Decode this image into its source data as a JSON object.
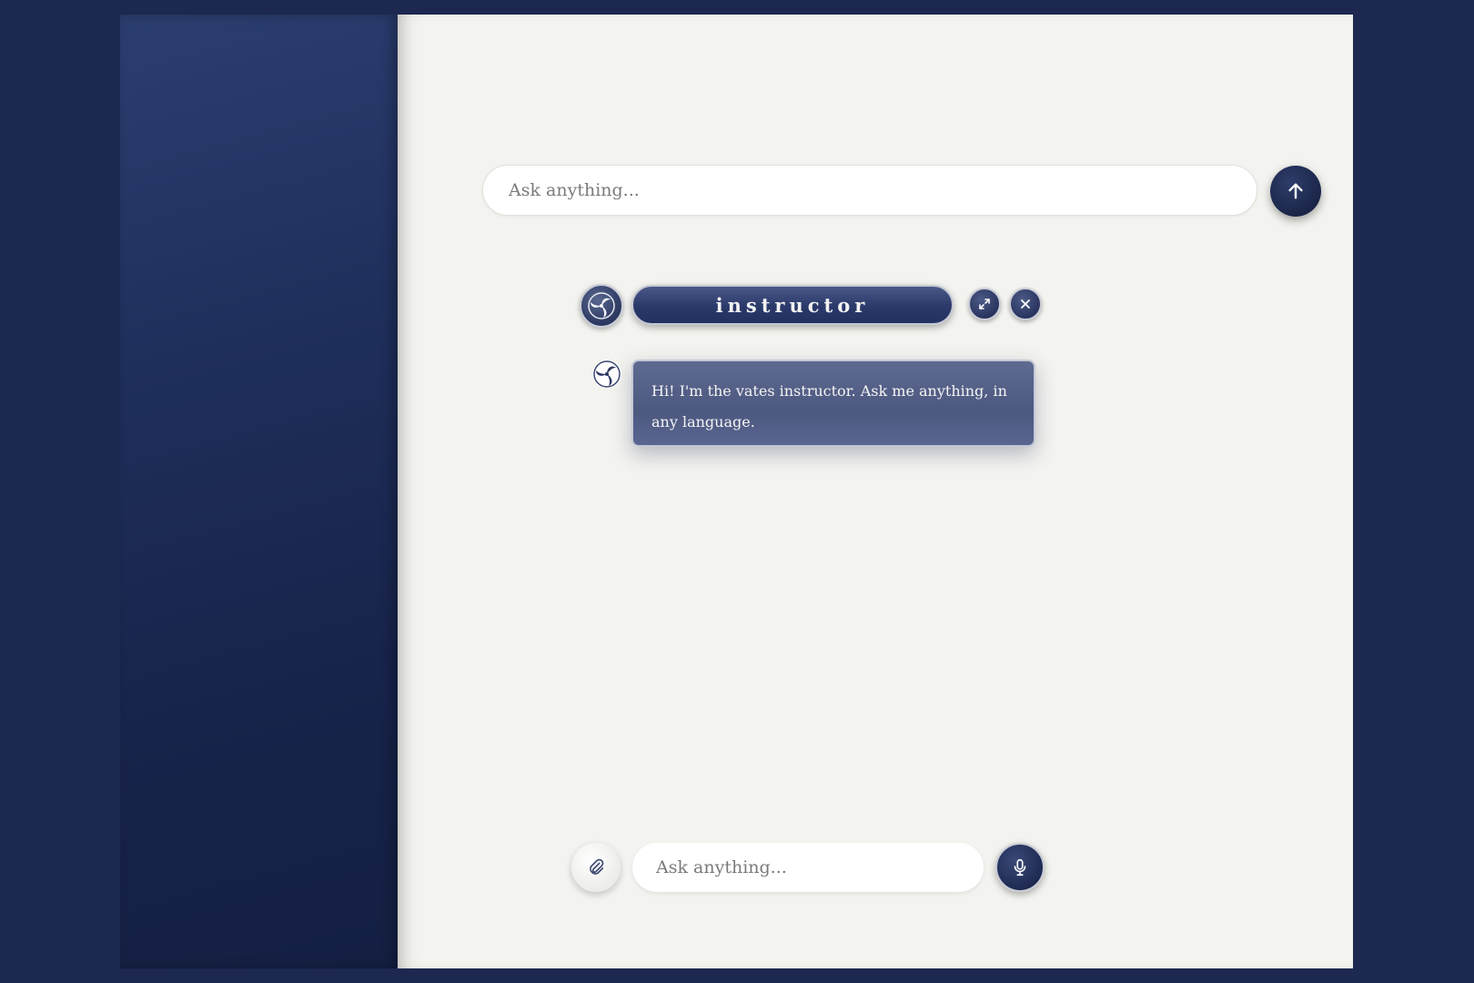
{
  "top_search": {
    "placeholder": "Ask anything..."
  },
  "send_button": {
    "icon": "arrow-up-icon"
  },
  "panel": {
    "title": "instructor",
    "avatar_icon": "triskele-logo-icon",
    "expand_icon": "expand-icon",
    "close_icon": "close-icon"
  },
  "messages": [
    {
      "role": "assistant",
      "text": "Hi! I'm the vates instructor. Ask me anything, in any language."
    }
  ],
  "bottom_bar": {
    "attach_icon": "paperclip-icon",
    "placeholder": "Ask anything...",
    "mic_icon": "microphone-icon"
  },
  "colors": {
    "navy": "#1c2850",
    "panel_bg": "#f3f3ef",
    "bubble": "#55618a"
  }
}
